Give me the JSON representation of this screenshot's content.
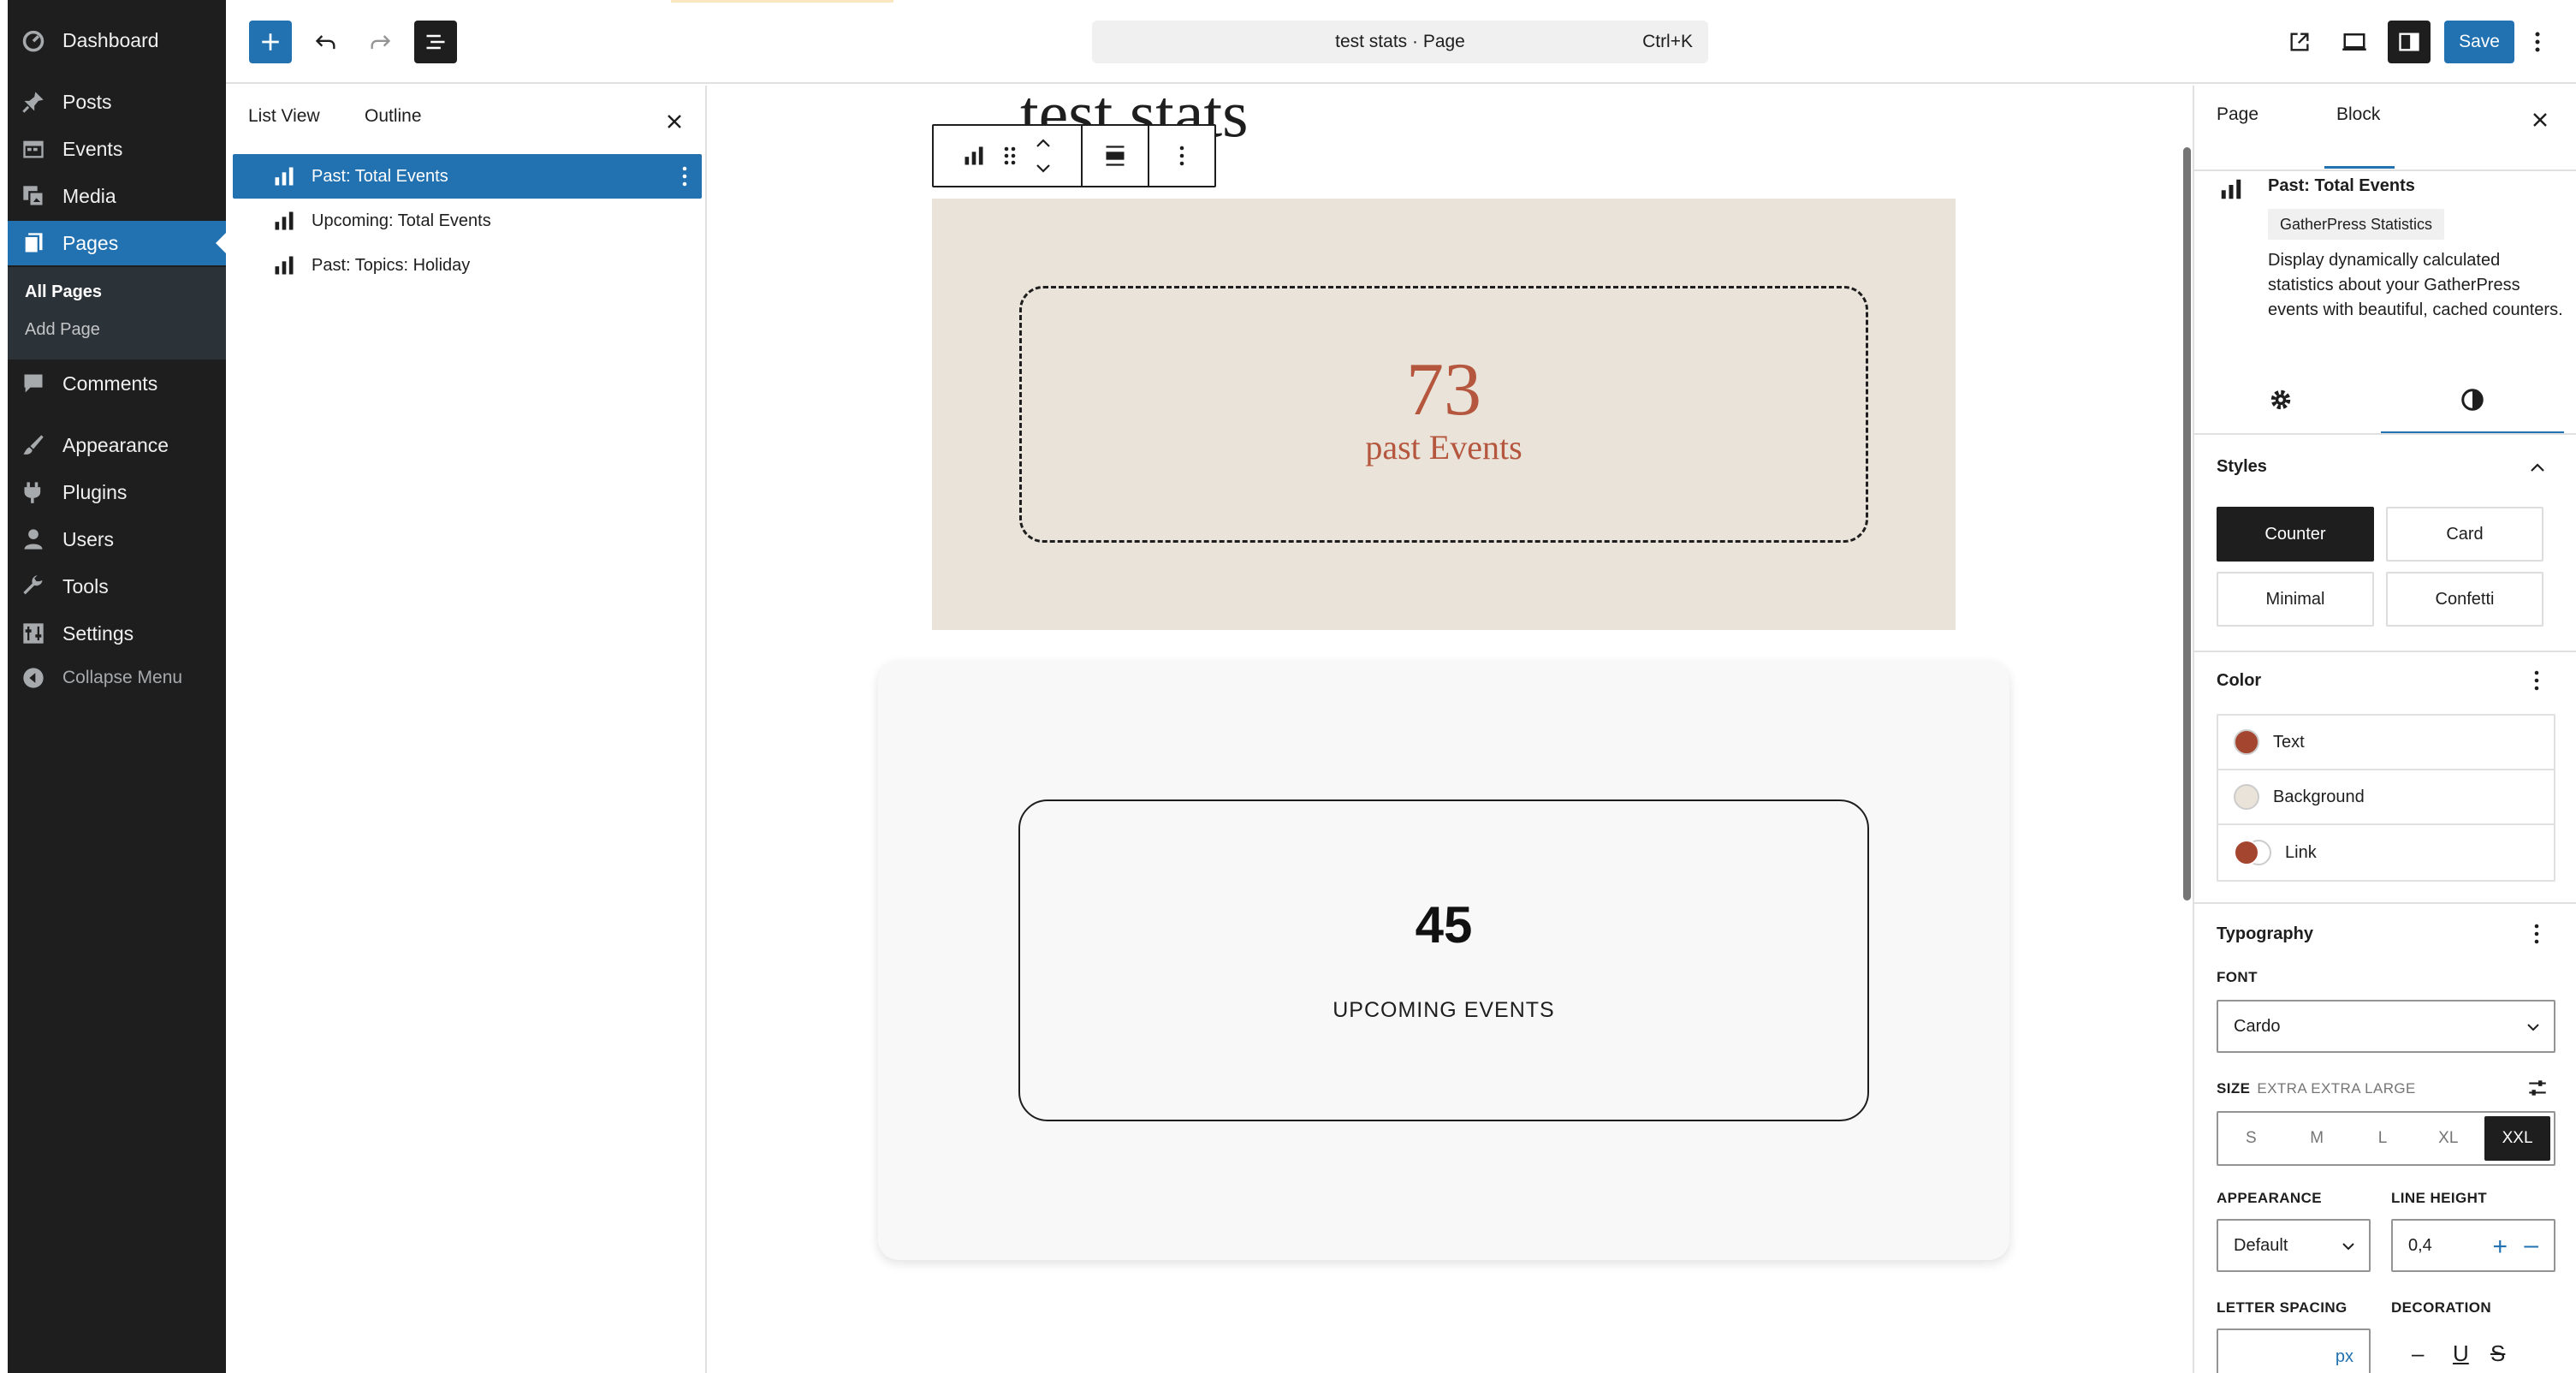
{
  "admin_menu": {
    "items": [
      {
        "label": "Dashboard",
        "icon": "dashboard-icon"
      },
      {
        "label": "Posts",
        "icon": "pin-icon"
      },
      {
        "label": "Events",
        "icon": "calendar-icon"
      },
      {
        "label": "Media",
        "icon": "media-icon"
      },
      {
        "label": "Pages",
        "icon": "pages-icon"
      },
      {
        "label": "Comments",
        "icon": "comment-icon"
      },
      {
        "label": "Appearance",
        "icon": "brush-icon"
      },
      {
        "label": "Plugins",
        "icon": "plugin-icon"
      },
      {
        "label": "Users",
        "icon": "user-icon"
      },
      {
        "label": "Tools",
        "icon": "wrench-icon"
      },
      {
        "label": "Settings",
        "icon": "settings-icon"
      }
    ],
    "submenu": [
      "All Pages",
      "Add Page"
    ],
    "collapse_label": "Collapse Menu"
  },
  "toolbar": {
    "document_title": "test stats · Page",
    "shortcut": "Ctrl+K",
    "save_label": "Save"
  },
  "list_view": {
    "tabs": [
      "List View",
      "Outline"
    ],
    "items": [
      "Past: Total Events",
      "Upcoming: Total Events",
      "Past: Topics: Holiday"
    ]
  },
  "canvas": {
    "page_title": "test stats",
    "blocks": [
      {
        "number": "73",
        "label": "past Events",
        "text_color": "#b5573e",
        "background": "#eae3d9"
      },
      {
        "number": "45",
        "label": "UPCOMING EVENTS"
      }
    ]
  },
  "settings": {
    "tabs": [
      "Page",
      "Block"
    ],
    "block_title": "Past: Total Events",
    "block_badge": "GatherPress Statistics",
    "block_description": "Display dynamically calculated statistics about your GatherPress events with beautiful, cached counters.",
    "styles_title": "Styles",
    "styles": [
      "Counter",
      "Card",
      "Minimal",
      "Confetti"
    ],
    "active_style": "Counter",
    "color_title": "Color",
    "colors": [
      {
        "label": "Text",
        "value": "#a4462f"
      },
      {
        "label": "Background",
        "value": "#eae3d9"
      },
      {
        "label": "Link",
        "value": "#a4462f"
      }
    ],
    "typography_title": "Typography",
    "font_label": "FONT",
    "font_value": "Cardo",
    "size_label": "SIZE",
    "size_value": "EXTRA EXTRA LARGE",
    "sizes": [
      "S",
      "M",
      "L",
      "XL",
      "XXL"
    ],
    "active_size": "XXL",
    "appearance_label": "APPEARANCE",
    "appearance_value": "Default",
    "line_height_label": "LINE HEIGHT",
    "line_height_value": "0,4",
    "letter_spacing_label": "LETTER SPACING",
    "letter_spacing_unit": "px",
    "decoration_label": "DECORATION"
  }
}
